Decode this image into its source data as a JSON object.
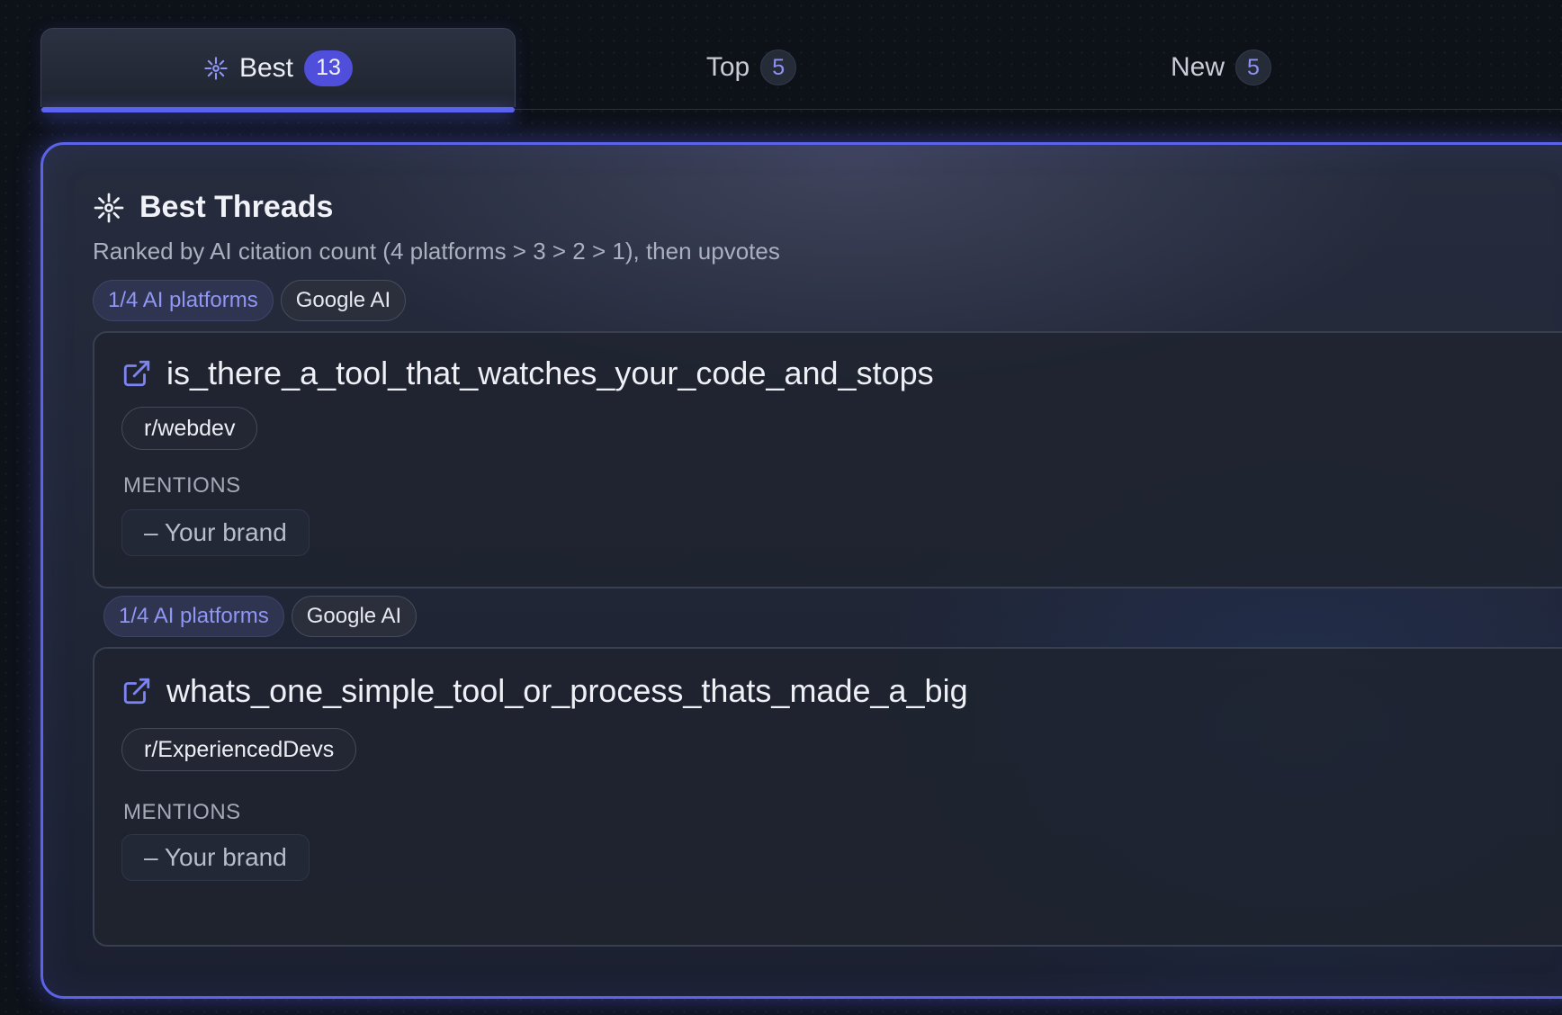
{
  "tabs": [
    {
      "label": "Best",
      "count": "13",
      "icon": "sparkle-icon",
      "active": true
    },
    {
      "label": "Top",
      "count": "5",
      "active": false
    },
    {
      "label": "New",
      "count": "5",
      "active": false
    }
  ],
  "panel": {
    "title": "Best Threads",
    "title_icon": "sparkle-icon",
    "subtitle": "Ranked by AI citation count (4 platforms > 3 > 2 > 1), then upvotes"
  },
  "threads": [
    {
      "platform_label": "1/4 AI platforms",
      "provider_label": "Google AI",
      "title": "is_there_a_tool_that_watches_your_code_and_stops",
      "subreddit": "r/webdev",
      "mentions_label": "MENTIONS",
      "mention": "– Your brand"
    },
    {
      "platform_label": "1/4 AI platforms",
      "provider_label": "Google AI",
      "title": "whats_one_simple_tool_or_process_thats_made_a_big",
      "subreddit": "r/ExperiencedDevs",
      "mentions_label": "MENTIONS",
      "mention": "– Your brand"
    }
  ],
  "colors": {
    "accent": "#5a63f0",
    "badge_active": "#4f4fdc",
    "platform_chip_text": "#8f96f3",
    "background": "#0d1118"
  }
}
